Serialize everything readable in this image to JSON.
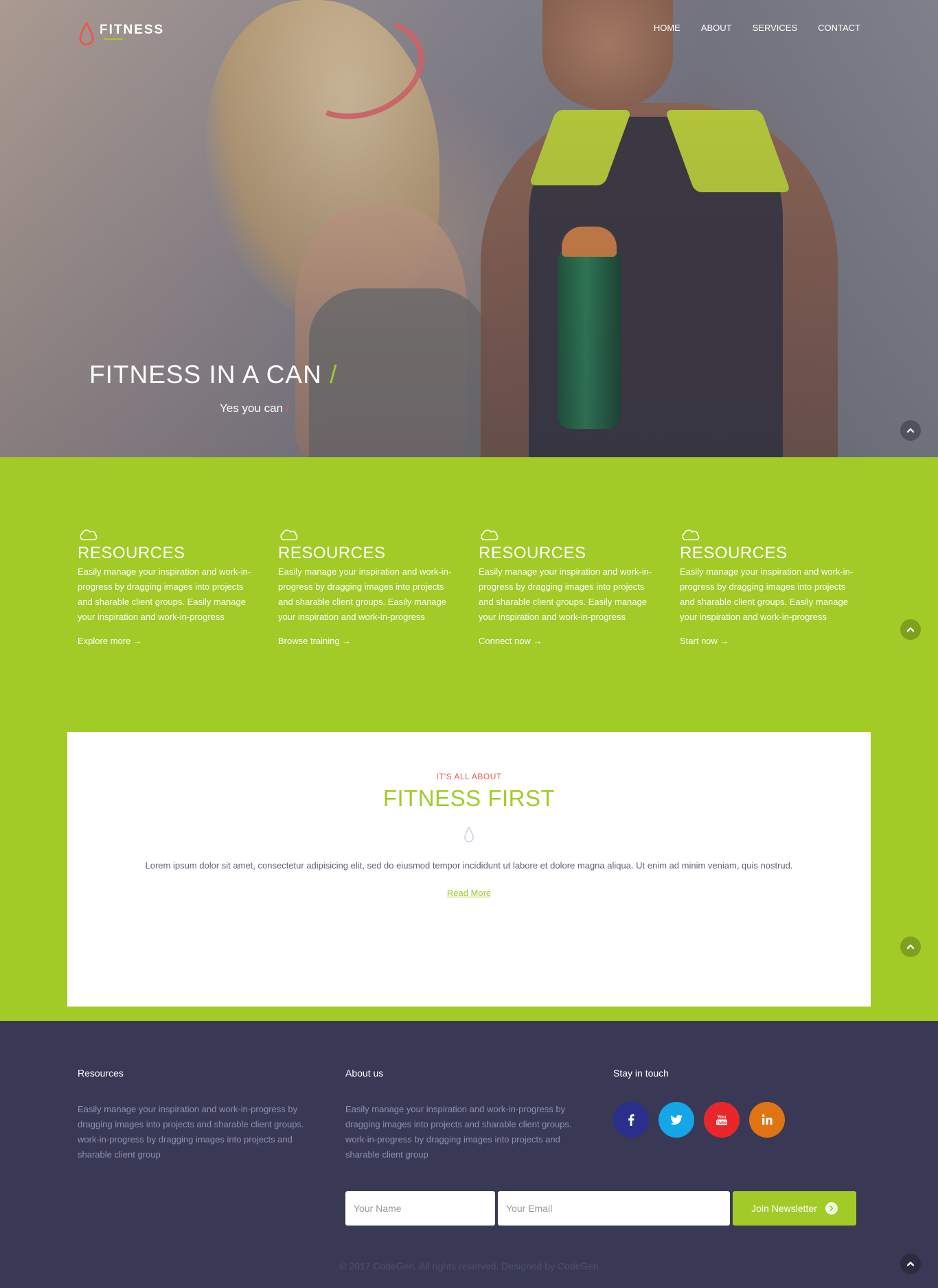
{
  "nav": {
    "logo_text": "FITNESS",
    "items": [
      {
        "label": "HOME"
      },
      {
        "label": "ABOUT"
      },
      {
        "label": "SERVICES"
      },
      {
        "label": "CONTACT"
      }
    ]
  },
  "hero": {
    "title": "FITNESS IN A CAN",
    "title_slash": "/",
    "subtitle": "Yes you can",
    "subtitle_slash": "/"
  },
  "features": [
    {
      "icon": "cloud-icon",
      "title": "RESOURCES",
      "text": "Easily manage your inspiration and work-in-progress by dragging images into projects and sharable client groups. Easily manage your inspiration and work-in-progress",
      "link": "Explore more →"
    },
    {
      "icon": "cloud-icon",
      "title": "RESOURCES",
      "text": "Easily manage your inspiration and work-in-progress by dragging images into projects and sharable client groups. Easily manage your inspiration and work-in-progress",
      "link": "Browse training →"
    },
    {
      "icon": "cloud-icon",
      "title": "RESOURCES",
      "text": "Easily manage your inspiration and work-in-progress by dragging images into projects and sharable client groups. Easily manage your inspiration and work-in-progress",
      "link": "Connect now →"
    },
    {
      "icon": "cloud-icon",
      "title": "RESOURCES",
      "text": "Easily manage your inspiration and work-in-progress by dragging images into projects and sharable client groups. Easily manage your inspiration and work-in-progress",
      "link": "Start now →"
    }
  ],
  "about": {
    "kicker": "IT'S ALL ABOUT",
    "title": "FITNESS FIRST",
    "text": "Lorem ipsum dolor sit amet, consectetur adipisicing elit, sed do eiusmod tempor incididunt ut labore et dolore magna aliqua. Ut enim ad minim veniam, quis nostrud.",
    "link": "Read More"
  },
  "footer": {
    "resources": {
      "heading": "Resources",
      "text": "Easily manage your inspiration and work-in-progress by dragging images into projects and sharable client groups. work-in-progress by dragging images into projects and sharable client group"
    },
    "about": {
      "heading": "About us",
      "text": "Easily manage your inspiration and work-in-progress by dragging images into projects and sharable client groups. work-in-progress by dragging images into projects and sharable client group"
    },
    "social": {
      "heading": "Stay in touch",
      "items": [
        {
          "icon": "facebook-icon",
          "color": "#2b2f8c"
        },
        {
          "icon": "twitter-icon",
          "color": "#14a6e6"
        },
        {
          "icon": "youtube-icon",
          "color": "#e8272a"
        },
        {
          "icon": "linkedin-icon",
          "color": "#e07413"
        }
      ]
    },
    "newsletter": {
      "name_placeholder": "Your Name",
      "email_placeholder": "Your Email",
      "button_label": "Join Newsletter"
    },
    "copyright": "© 2017 CodeGen. All rights reserved. Designed by CodeGen"
  },
  "colors": {
    "accent_green": "#a2cb27",
    "accent_red": "#e8594e",
    "footer_bg": "#393956"
  }
}
